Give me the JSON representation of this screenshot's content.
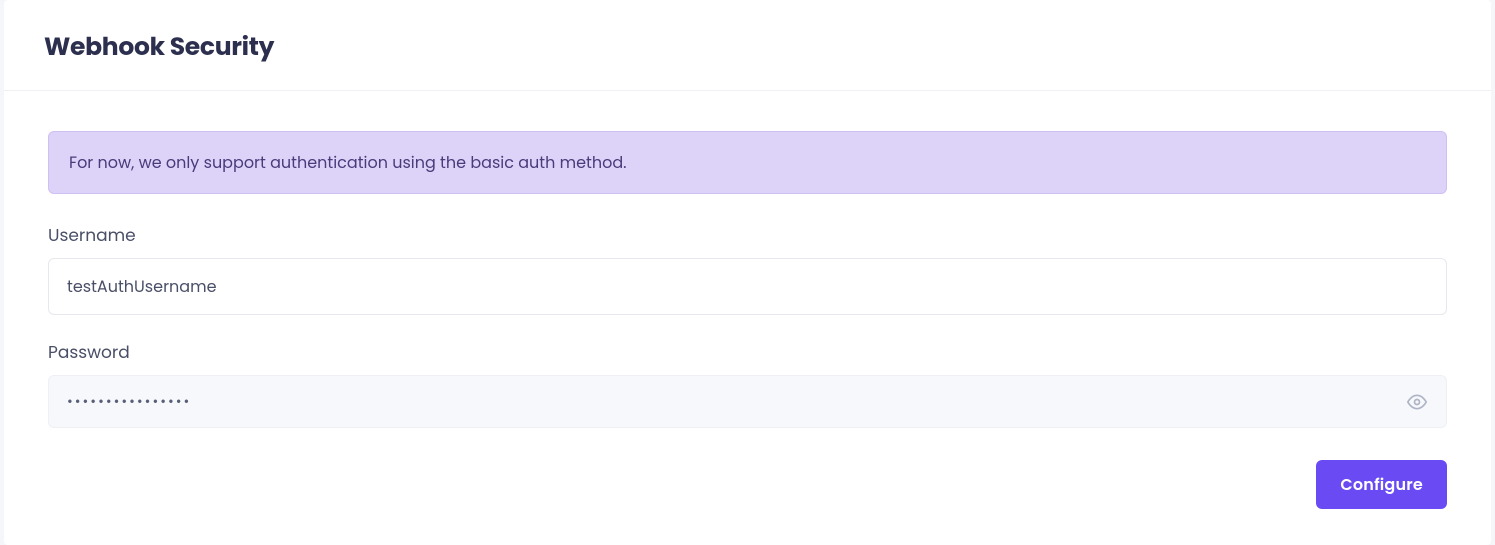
{
  "header": {
    "title": "Webhook Security"
  },
  "banner": {
    "message": "For now, we only support authentication using the basic auth method."
  },
  "form": {
    "username": {
      "label": "Username",
      "value": "testAuthUsername"
    },
    "password": {
      "label": "Password",
      "value": "••••••••••••••••"
    }
  },
  "actions": {
    "configure": "Configure"
  }
}
